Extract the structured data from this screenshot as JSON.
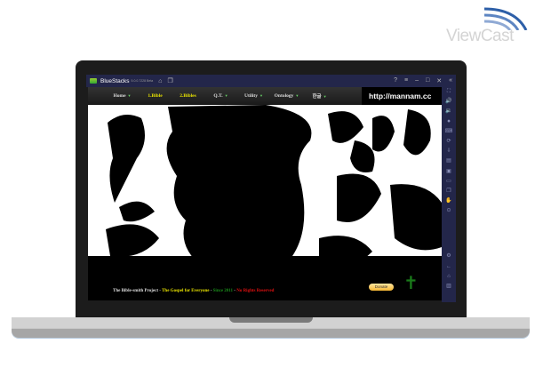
{
  "logo": {
    "text": "ViewCast",
    "color": "#d4d4d4",
    "arc_color": "#2d5fa8"
  },
  "window": {
    "title": "BlueStacks",
    "version": "5.0.0.7228 Beta",
    "home_icon": "home-icon",
    "multi_icon": "multi-instance-icon",
    "controls": [
      "help-icon",
      "menu-icon",
      "minimize-icon",
      "maximize-icon",
      "close-icon",
      "collapse-icon"
    ]
  },
  "sidebar": {
    "icons": [
      "fullscreen-icon",
      "volume-up-icon",
      "volume-down-icon",
      "screen-record-icon",
      "keyboard-icon",
      "rotate-icon",
      "install-apk-icon",
      "macro-icon",
      "screenshot-icon",
      "folder-icon",
      "multi-instance-icon",
      "shake-icon",
      "location-icon",
      "settings-icon",
      "back-icon",
      "home-icon",
      "recent-apps-icon"
    ]
  },
  "nav": {
    "items": [
      {
        "label": "Home",
        "highlight": false,
        "dropdown": true
      },
      {
        "label": "1.Bible",
        "highlight": true,
        "dropdown": false
      },
      {
        "label": "2.Bibles",
        "highlight": true,
        "dropdown": false
      },
      {
        "label": "Q.T.",
        "highlight": false,
        "dropdown": true
      },
      {
        "label": "Utility",
        "highlight": false,
        "dropdown": true
      },
      {
        "label": "Ontology",
        "highlight": false,
        "dropdown": true
      },
      {
        "label": "한글",
        "highlight": false,
        "dropdown": true
      }
    ],
    "url": "http://mannam.cc",
    "highlight_color": "#e8e200"
  },
  "footer": {
    "segments": [
      {
        "text": "The Bible-smith Project",
        "color": "#dddddd"
      },
      {
        "text": " - ",
        "color": "#dddddd"
      },
      {
        "text": "The Gospel for Everyone",
        "color": "#e8e200"
      },
      {
        "text": " - ",
        "color": "#dddddd"
      },
      {
        "text": "Since 2011",
        "color": "#1a8c1a"
      },
      {
        "text": " - ",
        "color": "#dddddd"
      },
      {
        "text": "No Rights Reserved",
        "color": "#e01010"
      }
    ],
    "donate_label": "Donate",
    "cross_icon": "cross-icon"
  }
}
